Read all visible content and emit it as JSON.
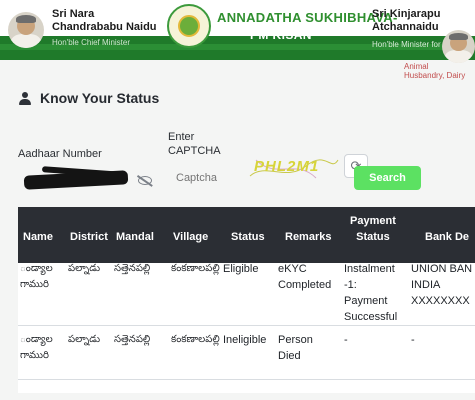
{
  "header": {
    "left_name": [
      "Sri Nara",
      "Chandrababu Naidu"
    ],
    "left_role": "Hon'ble Chief Minister",
    "title_line1": "ANNADATHA SUKHIBHAVA-",
    "title_line2": "PM KISAN",
    "right_name": [
      "Sri Kinjarapu",
      "Atchannaidu"
    ],
    "right_role": "Hon'ble Minister for",
    "right_role2": [
      "Animal",
      "Husbandry, Dairy"
    ],
    "colors": {
      "brand_green": "#1f7a2a",
      "title_green": "#2f8f2f"
    }
  },
  "page": {
    "heading": "Know Your Status",
    "heading_icon": "user-icon"
  },
  "form": {
    "aadhaar_label": "Aadhaar Number",
    "captcha_label": [
      "Enter",
      "CAPTCHA"
    ],
    "captcha_placeholder": "Captcha",
    "captcha_image_text": "PHL2M1",
    "refresh_icon": "refresh-icon",
    "toggle_icon": "eye-slash-icon",
    "search_label": "Search",
    "search_color": "#5ce162"
  },
  "table": {
    "headers": {
      "name": "Name",
      "district": "District",
      "mandal": "Mandal",
      "village": "Village",
      "status": "Status",
      "remarks": "Remarks",
      "payment_status": [
        "Payment",
        "Status"
      ],
      "bank": "Bank De"
    },
    "rows": [
      {
        "name": [
          "ండ్యాల",
          "గామురి"
        ],
        "district": "పల్నాడు",
        "mandal": "సత్తెనపల్లి",
        "village": "కంకణాలపల్లి",
        "status": "Eligible",
        "remarks": [
          "eKYC",
          "Completed"
        ],
        "payment": [
          "Instalment",
          "-1:",
          "Payment",
          "Successful"
        ],
        "bank": [
          "UNION BAN",
          "INDIA",
          "XXXXXXXX"
        ]
      },
      {
        "name": [
          "ండ్యాల",
          "గామురి"
        ],
        "district": "పల్నాడు",
        "mandal": "సత్తెనపల్లి",
        "village": "కంకణాలపల్లి",
        "status": "Ineligible",
        "remarks": [
          "Person",
          "Died"
        ],
        "payment": [
          "-"
        ],
        "bank": [
          "-"
        ]
      }
    ]
  }
}
